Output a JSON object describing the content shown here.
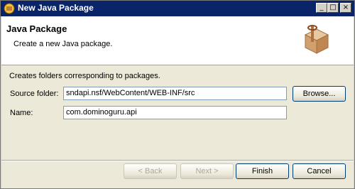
{
  "window": {
    "title": "New Java Package",
    "buttons": {
      "minimize": "_",
      "maximize": "□",
      "close": "×"
    }
  },
  "header": {
    "title": "Java Package",
    "subtitle": "Create a new Java package.",
    "icon": "package-icon"
  },
  "form": {
    "description": "Creates folders corresponding to packages.",
    "source_folder_label": "Source folder:",
    "source_folder_value": "sndapi.nsf/WebContent/WEB-INF/src",
    "browse_label": "Browse...",
    "name_label": "Name:",
    "name_value": "com.dominoguru.api"
  },
  "footer": {
    "back": "< Back",
    "next": "Next >",
    "finish": "Finish",
    "cancel": "Cancel"
  },
  "colors": {
    "titlebar": "#0a246a",
    "header_bg": "#ffffff",
    "body_bg": "#ece9d8"
  }
}
